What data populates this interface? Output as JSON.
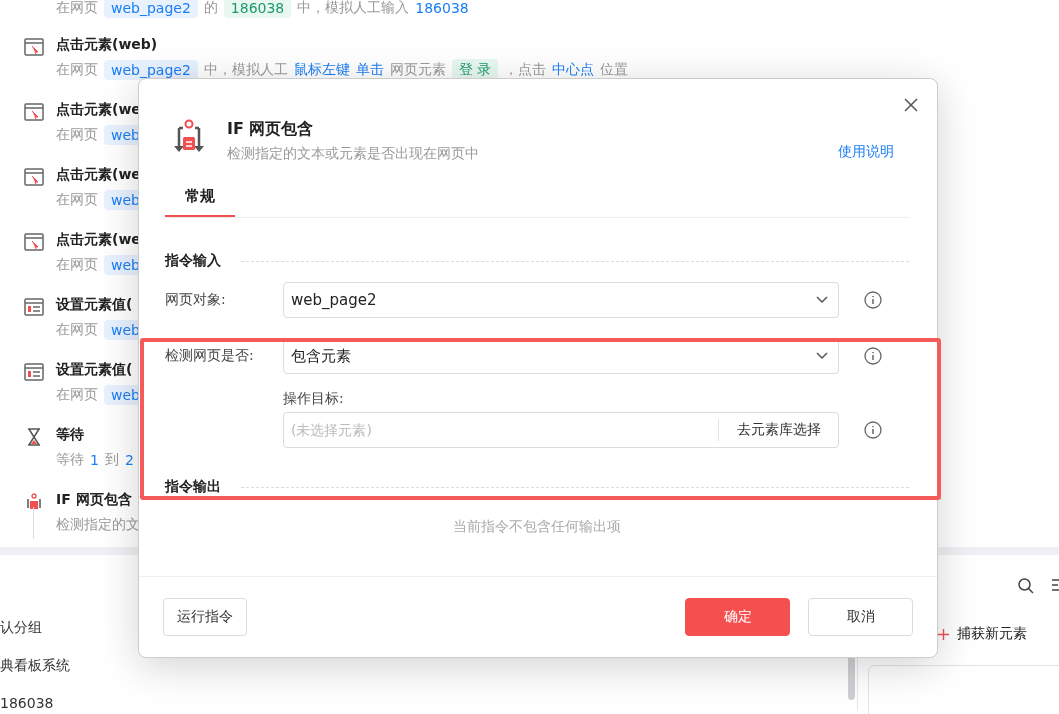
{
  "steps": [
    {
      "kind": "text",
      "desc": [
        {
          "kind": "plain",
          "text": "在网页"
        },
        {
          "kind": "var",
          "text": "web_page2"
        },
        {
          "kind": "plain",
          "text": "的"
        },
        {
          "kind": "value",
          "text": "186038"
        },
        {
          "kind": "plain",
          "text": "中，模拟人工输入"
        },
        {
          "kind": "link",
          "text": "186038"
        }
      ]
    },
    {
      "kind": "click",
      "title": "点击元素(web)",
      "desc": [
        {
          "kind": "plain",
          "text": "在网页"
        },
        {
          "kind": "var",
          "text": "web_page2"
        },
        {
          "kind": "plain",
          "text": "中，模拟人工"
        },
        {
          "kind": "link",
          "text": "鼠标左键"
        },
        {
          "kind": "link",
          "text": "单击"
        },
        {
          "kind": "plain",
          "text": "网页元素"
        },
        {
          "kind": "value",
          "text": "登 录"
        },
        {
          "kind": "plain",
          "text": "，点击"
        },
        {
          "kind": "link",
          "text": "中心点"
        },
        {
          "kind": "plain",
          "text": "位置"
        }
      ]
    },
    {
      "kind": "click",
      "title": "点击元素(we",
      "desc": [
        {
          "kind": "plain",
          "text": "在网页"
        },
        {
          "kind": "var",
          "text": "web"
        }
      ]
    },
    {
      "kind": "click",
      "title": "点击元素(we",
      "desc": [
        {
          "kind": "plain",
          "text": "在网页"
        },
        {
          "kind": "var",
          "text": "web"
        }
      ]
    },
    {
      "kind": "click",
      "title": "点击元素(we",
      "desc": [
        {
          "kind": "plain",
          "text": "在网页"
        },
        {
          "kind": "var",
          "text": "web"
        }
      ]
    },
    {
      "kind": "form",
      "title": "设置元素值(",
      "desc": [
        {
          "kind": "plain",
          "text": "在网页"
        },
        {
          "kind": "var",
          "text": "web"
        }
      ]
    },
    {
      "kind": "form",
      "title": "设置元素值(",
      "desc": [
        {
          "kind": "plain",
          "text": "在网页"
        },
        {
          "kind": "var",
          "text": "web"
        }
      ]
    },
    {
      "kind": "wait",
      "title": "等待",
      "desc": [
        {
          "kind": "plain",
          "text": "等待"
        },
        {
          "kind": "link",
          "text": "1"
        },
        {
          "kind": "plain",
          "text": "到"
        },
        {
          "kind": "link",
          "text": "2"
        }
      ]
    },
    {
      "kind": "if",
      "title": "IF 网页包含",
      "desc": [
        {
          "kind": "plain",
          "text": "检测指定的文"
        }
      ]
    }
  ],
  "groups": [
    "认分组",
    "典看板系统",
    "186038"
  ],
  "capture_button": "捕获新元素",
  "dialog": {
    "title": "IF 网页包含",
    "subtitle": "检测指定的文本或元素是否出现在网页中",
    "help_link": "使用说明",
    "tabs": [
      {
        "label": "常规",
        "selected": true
      }
    ],
    "input_section": "指令输入",
    "web_object": {
      "label": "网页对象:",
      "value": "web_page2"
    },
    "detect": {
      "label": "检测网页是否:",
      "value": "包含元素"
    },
    "target": {
      "label": "操作目标:",
      "placeholder": "(未选择元素)",
      "button": "去元素库选择"
    },
    "output_section": "指令输出",
    "output_empty": "当前指令不包含任何输出项",
    "run_button": "运行指令",
    "ok_button": "确定",
    "cancel_button": "取消"
  }
}
